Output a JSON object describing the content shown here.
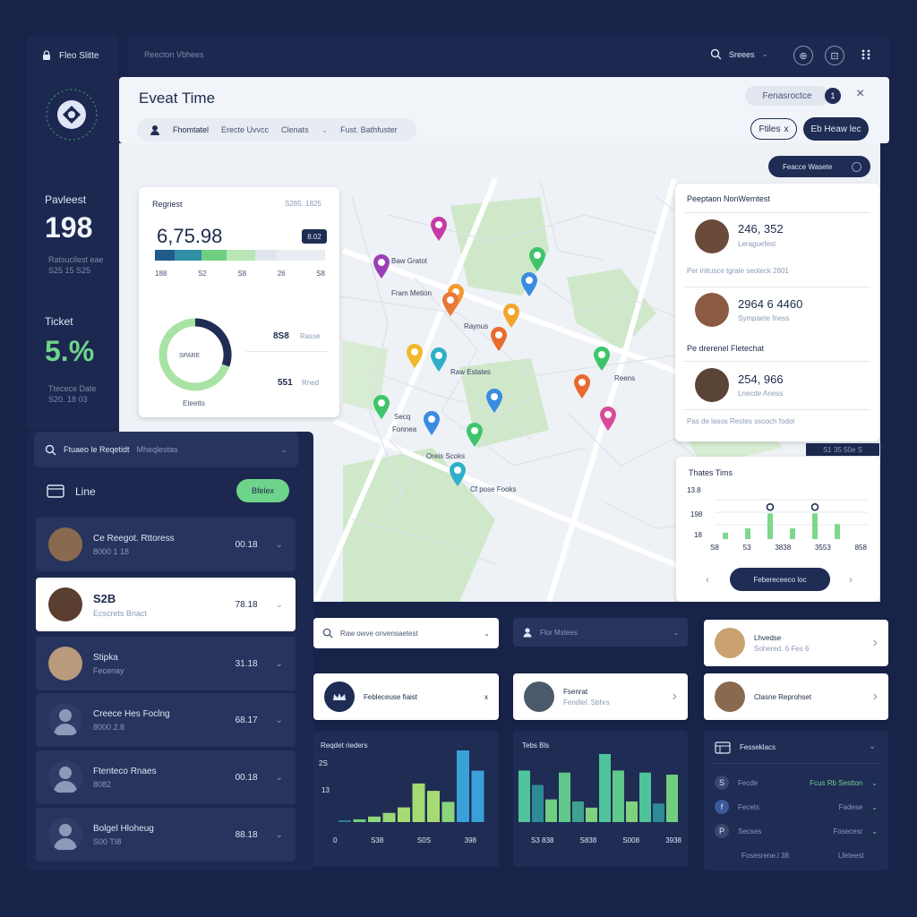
{
  "sidebar": {
    "brand": "Fleo Slitte",
    "kpis": [
      {
        "label": "Pavleest",
        "value": "198",
        "sub1": "Ratsucilest eae",
        "sub2": "S25 15 S25"
      },
      {
        "label": "Ticket",
        "value": "5.%",
        "sub1": "Ttecece Date",
        "sub2": "S20. 18 03"
      }
    ]
  },
  "topbar": {
    "title": "Reecton Vbhees",
    "search_label": "Sreees",
    "btn1": "⊕",
    "btn2": "⊡"
  },
  "event": {
    "title": "Eveat Time",
    "pill_right": "Fenasroctce",
    "badge": "1",
    "close": "×",
    "chips": [
      "Fhomtatel",
      "Erecte Uvvcc",
      "Clenats",
      "Fust. Bathfuster"
    ],
    "btn_filter": "Ftiles",
    "btn_filter_mark": "x",
    "btn_primary": "Eb Heaw lec"
  },
  "map": {
    "overlay_btn": "Feacce Wasete",
    "labels": [
      "Baw Gratot",
      "Fram Metion",
      "Raynus",
      "Raw Estates",
      "Reens",
      "Secq",
      "Fonnea",
      "Oreis Scoks",
      "Cf pose Fooks"
    ]
  },
  "stats_card": {
    "title": "Regriest",
    "top_right": "S285. 1825",
    "big_value": "6,75.98",
    "badge": "8.02",
    "scale": [
      "188",
      "S2",
      "S8",
      "26",
      "S8"
    ],
    "donut_center": "SPARE",
    "donut_caption": "Eteetts",
    "stat_rows": [
      {
        "value": "8S8",
        "label": "Rasse"
      },
      {
        "value": "551",
        "label": "Rned"
      }
    ]
  },
  "right_card": {
    "title": "Peeptaon NonWemtest",
    "entries": [
      {
        "value": "246, 352",
        "sub": "Leraguefest"
      },
      {
        "value": "2964 6 4460",
        "sub": "Sympaete fness"
      },
      {
        "value": "254, 966",
        "sub": "Lnecde Aness"
      }
    ],
    "mid_notes": [
      "Per initusce tgrale seoteck 2801",
      "Pe drerenel Fletechat"
    ],
    "footer": "Pas de lasos Restes ssooch fodol",
    "tag": "S1 35 50e S"
  },
  "ttime_card": {
    "title": "Thates Tims",
    "y_ticks": [
      "13.8",
      "198",
      "18"
    ],
    "x_ticks": [
      "S8",
      "53",
      "3838",
      "3553",
      "858"
    ],
    "bars": [
      0.15,
      0.25,
      0.6,
      0.25,
      0.6,
      0.35
    ],
    "button": "Febereceeco loc",
    "prev": "‹",
    "next": "›"
  },
  "left_panel": {
    "search_text": "Ftuaeo le Reqetidt",
    "search_extra": "Mheqlestas",
    "section_title": "Line",
    "section_button": "Bfelex",
    "rows": [
      {
        "title": "Ce Reegot. Rttoress",
        "sub": "8000 1 18",
        "value": "00.18"
      },
      {
        "title": "S2B",
        "sub": "Ecscrets Bnact",
        "value": "78.18"
      },
      {
        "title": "Stipka",
        "sub": "Fecenay",
        "value": "31.18"
      },
      {
        "title": "Creece Hes Foclng",
        "sub": "8000 2.8",
        "value": "68.17"
      },
      {
        "title": "Ftenteco Rnaes",
        "sub": "8082",
        "value": "00.18"
      },
      {
        "title": "Bolgel Hloheug",
        "sub": "S00 TI8",
        "value": "88.18"
      }
    ]
  },
  "search2": {
    "text": "Raw owve onvensaetest"
  },
  "dropdown2": {
    "text": "Flor Mstees"
  },
  "mini_cards": [
    {
      "title": "Febleceuse fiaist",
      "mark": "x"
    },
    {
      "title": "Fsenrat",
      "sub": "Fendiel. Sbhrs"
    },
    {
      "title": "Lhvedse",
      "sub": "Sohered. 6 Fes 6"
    },
    {
      "title": "Clasne Reprohset"
    }
  ],
  "chart1": {
    "title": "Reqdet rieders",
    "y_ticks": [
      "2S",
      "13"
    ],
    "x_ticks": [
      "0",
      "S38",
      "S0S",
      "398"
    ],
    "values": [
      2,
      3,
      6,
      10,
      16,
      42,
      34,
      22,
      78,
      56
    ],
    "colors": [
      "#2f7d8a",
      "#6fcf7f",
      "#8fd97a",
      "#9ad678",
      "#a6da72",
      "#a6da72",
      "#a6da72",
      "#8ad47c",
      "#3aa0d8",
      "#3aa0d8"
    ]
  },
  "chart2": {
    "title": "Tebs Bls",
    "x_ticks": [
      "S3 838",
      "S838",
      "S008",
      "3938"
    ],
    "values": [
      50,
      36,
      22,
      48,
      20,
      14,
      66,
      50,
      20,
      48,
      18,
      46
    ],
    "colors": [
      "#4fc39a",
      "#2e8a96",
      "#6fcf7f",
      "#5fc88a",
      "#3ea28f",
      "#7fd27d",
      "#4fc39a",
      "#5fc88a",
      "#7fd27d",
      "#4fc39a",
      "#2e8a96",
      "#6fcf7f"
    ]
  },
  "settings_panel": {
    "title": "Fesseklacs",
    "rows": [
      {
        "icon": "S",
        "label": "Fecde",
        "value": "Fcus Rb Sestton",
        "accent": true
      },
      {
        "icon": "f",
        "label": "Fecets",
        "value": "Fadese"
      },
      {
        "icon": "P",
        "label": "Secses",
        "value": "Fosecesr"
      }
    ],
    "footer_label": "Fosesrene.l 38",
    "footer_value": "Lfeteest"
  }
}
